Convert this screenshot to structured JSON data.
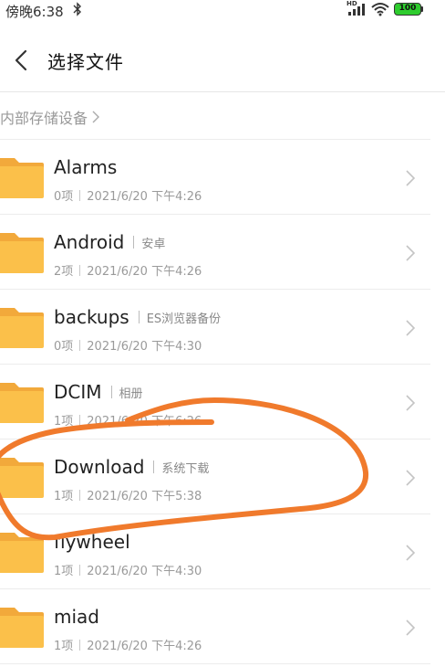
{
  "status_bar": {
    "time": "傍晚6:38",
    "network": "HD",
    "battery": "100"
  },
  "header": {
    "title": "选择文件"
  },
  "breadcrumb": {
    "label": "内部存储设备"
  },
  "files": [
    {
      "name": "Alarms",
      "tag": "",
      "count": "0项",
      "modified": "2021/6/20 下午4:26"
    },
    {
      "name": "Android",
      "tag": "安卓",
      "count": "2项",
      "modified": "2021/6/20 下午4:26"
    },
    {
      "name": "backups",
      "tag": "ES浏览器备份",
      "count": "0项",
      "modified": "2021/6/20 下午4:30"
    },
    {
      "name": "DCIM",
      "tag": "相册",
      "count": "1项",
      "modified": "2021/6/20 下午6:26"
    },
    {
      "name": "Download",
      "tag": "系统下载",
      "count": "1项",
      "modified": "2021/6/20 下午5:38"
    },
    {
      "name": "flywheel",
      "tag": "",
      "count": "1项",
      "modified": "2021/6/20 下午4:30"
    },
    {
      "name": "miad",
      "tag": "",
      "count": "1项",
      "modified": "2021/6/20 下午4:26"
    }
  ],
  "colors": {
    "folder": "#FBC04A",
    "annotation": "#F07A2C",
    "battery": "#2ECC2E"
  },
  "icons": {
    "back": "back-arrow-icon",
    "folder": "folder-icon",
    "chevron": "chevron-right-icon"
  }
}
